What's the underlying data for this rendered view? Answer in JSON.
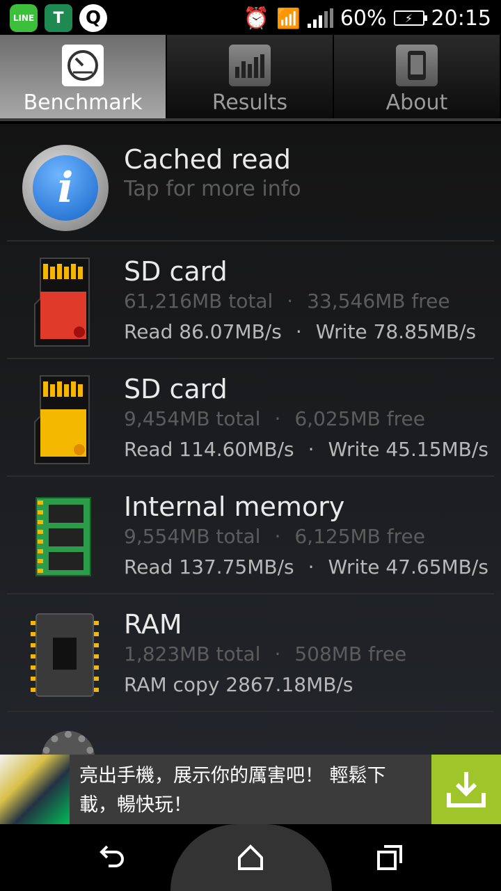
{
  "status": {
    "battery": "60%",
    "time": "20:15",
    "apps": [
      "LINE",
      "T",
      "Q"
    ]
  },
  "tabs": [
    {
      "label": "Benchmark",
      "icon": "speedometer-icon",
      "active": true
    },
    {
      "label": "Results",
      "icon": "bar-chart-icon",
      "active": false
    },
    {
      "label": "About",
      "icon": "phone-icon",
      "active": false
    }
  ],
  "info": {
    "title": "Cached read",
    "subtitle": "Tap for more info"
  },
  "storage": [
    {
      "title": "SD card",
      "total": "61,216MB total",
      "free": "33,546MB free",
      "read": "Read 86.07MB/s",
      "write": "Write 78.85MB/s"
    },
    {
      "title": "SD card",
      "total": "9,454MB total",
      "free": "6,025MB free",
      "read": "Read 114.60MB/s",
      "write": "Write 45.15MB/s"
    },
    {
      "title": "Internal memory",
      "total": "9,554MB total",
      "free": "6,125MB free",
      "read": "Read 137.75MB/s",
      "write": "Write 47.65MB/s"
    },
    {
      "title": "RAM",
      "total": "1,823MB total",
      "free": "508MB free",
      "read": "RAM copy 2867.18MB/s"
    }
  ],
  "separator": "·",
  "ad": {
    "line1": "亮出手機，展示你的厲害吧！ 輕鬆下",
    "line2": "載，暢快玩！"
  },
  "colors": {
    "accent_green": "#9fc52b",
    "sd_red": "#e03a2a",
    "sd_yellow": "#f5b800",
    "chip_green": "#2d9c4a"
  }
}
